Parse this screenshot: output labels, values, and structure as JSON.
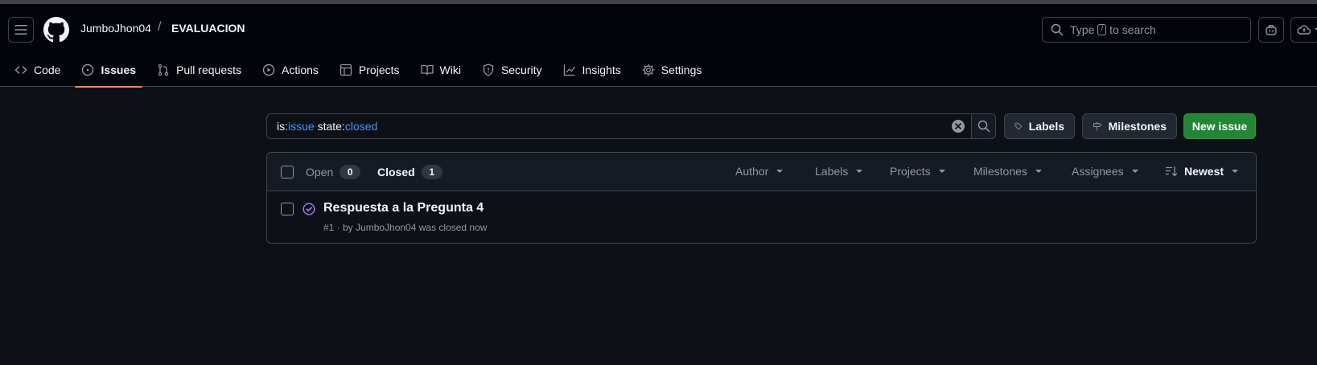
{
  "header": {
    "owner": "JumboJhon04",
    "separator": "/",
    "repo": "EVALUACION",
    "search_prefix": "Type",
    "search_kbd": "/",
    "search_suffix": "to search"
  },
  "tabs": [
    {
      "label": "Code",
      "icon": "code-icon"
    },
    {
      "label": "Issues",
      "icon": "issue-opened-icon",
      "active": true
    },
    {
      "label": "Pull requests",
      "icon": "git-pull-request-icon"
    },
    {
      "label": "Actions",
      "icon": "play-icon"
    },
    {
      "label": "Projects",
      "icon": "table-icon"
    },
    {
      "label": "Wiki",
      "icon": "book-icon"
    },
    {
      "label": "Security",
      "icon": "shield-icon"
    },
    {
      "label": "Insights",
      "icon": "graph-icon"
    },
    {
      "label": "Settings",
      "icon": "gear-icon"
    }
  ],
  "filter": {
    "kw1": "is:",
    "val1": "issue",
    "kw2": " state:",
    "val2": "closed"
  },
  "buttons": {
    "labels": "Labels",
    "milestones": "Milestones",
    "new_issue": "New issue"
  },
  "list_header": {
    "open_label": "Open",
    "open_count": "0",
    "closed_label": "Closed",
    "closed_count": "1",
    "filters": [
      "Author",
      "Labels",
      "Projects",
      "Milestones",
      "Assignees"
    ],
    "sort": "Newest"
  },
  "issues": [
    {
      "title": "Respuesta a la Pregunta 4",
      "meta": "#1 · by JumboJhon04 was closed now"
    }
  ],
  "colors": {
    "accent_underline": "#f78166",
    "closed_icon": "#ab7df8",
    "new_issue_bg": "#238636",
    "filter_value": "#4493f8"
  }
}
